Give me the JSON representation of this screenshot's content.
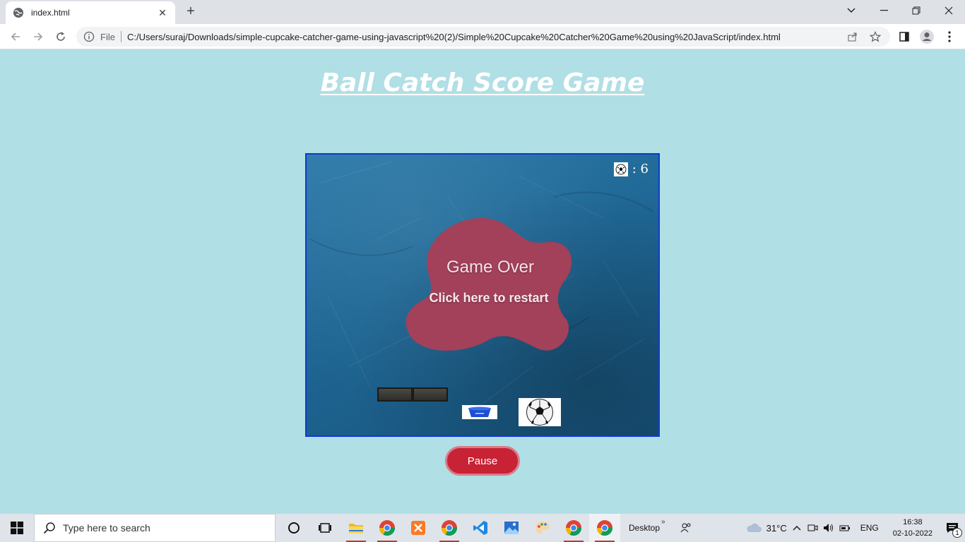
{
  "browser": {
    "tab_title": "index.html",
    "scheme_label": "File",
    "url": "C:/Users/suraj/Downloads/simple-cupcake-catcher-game-using-javascript%20(2)/Simple%20Cupcake%20Catcher%20Game%20using%20JavaScript/index.html",
    "new_tab_symbol": "+",
    "close_tab_symbol": "✕"
  },
  "page": {
    "title": "Ball Catch Score Game"
  },
  "game": {
    "score_text": ": 6",
    "game_over_text": "Game Over",
    "restart_text": "Click here to restart",
    "overlay_color": "#a3405a",
    "background_color": "#1f6795"
  },
  "controls": {
    "pause_label": "Pause",
    "pause_color": "#c82235"
  },
  "taskbar": {
    "search_placeholder": "Type here to search",
    "desktop_label": "Desktop",
    "temperature": "31°C",
    "language": "ENG",
    "time": "16:38",
    "date": "02-10-2022",
    "notification_count": "1",
    "apps": [
      "chrome",
      "file-explorer",
      "chrome",
      "xampp",
      "chrome",
      "vscode",
      "photos",
      "paint",
      "chrome",
      "chrome"
    ]
  }
}
